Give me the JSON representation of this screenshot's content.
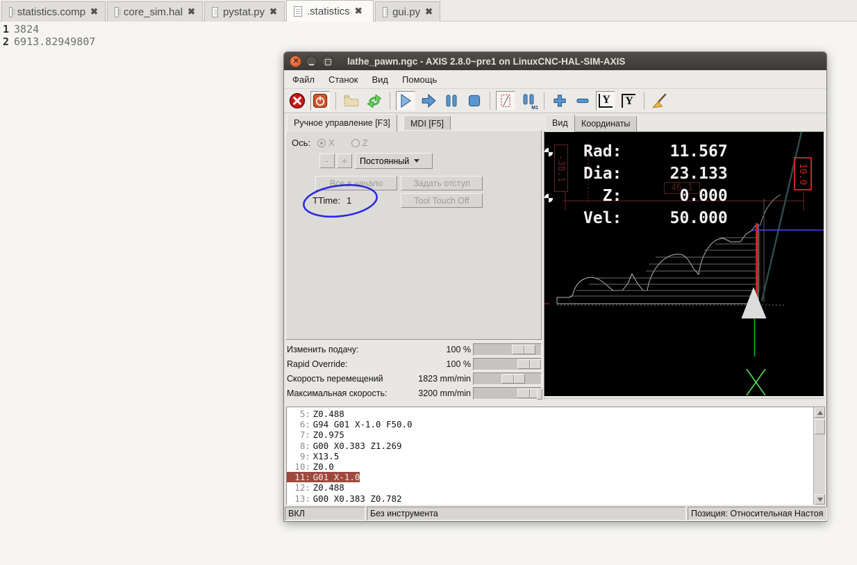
{
  "editor": {
    "tabs": [
      {
        "label": "statistics.comp"
      },
      {
        "label": "core_sim.hal"
      },
      {
        "label": "pystat.py"
      },
      {
        "label": ".statistics"
      },
      {
        "label": "gui.py"
      }
    ],
    "lines": [
      {
        "num": "1",
        "text": "3824"
      },
      {
        "num": "2",
        "text": "6913.82949807"
      }
    ]
  },
  "window": {
    "title": "lathe_pawn.ngc - AXIS 2.8.0~pre1 on LinuxCNC-HAL-SIM-AXIS",
    "menu": [
      "Файл",
      "Станок",
      "Вид",
      "Помощь"
    ]
  },
  "toolbar": {
    "m1_label": "M1",
    "view_y_label": "Y",
    "view_y2_label": "Y"
  },
  "left_panel": {
    "tab_manual": "Ручное управление [F3]",
    "tab_mdi": "MDI [F5]",
    "axis_label": "Ось:",
    "axis_x": "X",
    "axis_z": "Z",
    "jog_minus": "-",
    "jog_plus": "+",
    "jog_mode": "Постоянный",
    "home_all": "Все в начало",
    "set_offset": "Задать отступ",
    "ttime_label": "TTime:",
    "ttime_value": "1",
    "tool_touch_off": "Tool Touch Off"
  },
  "overrides": {
    "rows": [
      {
        "label": "Изменить подачу:",
        "value": "100 %"
      },
      {
        "label": "Rapid Override:",
        "value": "100 %"
      },
      {
        "label": "Скорость перемещений",
        "value": "1823 mm/min"
      },
      {
        "label": "Максимальная скорость:",
        "value": "3200 mm/min"
      }
    ]
  },
  "preview": {
    "tab_view": "Вид",
    "tab_coords": "Координаты",
    "dro": {
      "rad_label": "Rad:",
      "rad": "11.567",
      "dia_label": "Dia:",
      "dia": "23.133",
      "z_label": "Z:",
      "z": "0.000",
      "vel_label": "Vel:",
      "vel": "50.000"
    },
    "dims": {
      "left": "-38.1",
      "mid": "46.1",
      "right": "10.0"
    }
  },
  "gcode": {
    "lines": [
      {
        "num": "5:",
        "text": "Z0.488"
      },
      {
        "num": "6:",
        "text": "G94 G01 X-1.0 F50.0"
      },
      {
        "num": "7:",
        "text": "Z0.975"
      },
      {
        "num": "8:",
        "text": "G00 X0.383 Z1.269"
      },
      {
        "num": "9:",
        "text": "X13.5"
      },
      {
        "num": "10:",
        "text": "Z0.0"
      },
      {
        "num": "11:",
        "text": "G01 X-1.0"
      },
      {
        "num": "12:",
        "text": "Z0.488"
      },
      {
        "num": "13:",
        "text": "G00 X0.383 Z0.782"
      }
    ]
  },
  "statusbar": {
    "power": "ВКЛ",
    "tool": "Без инструмента",
    "position": "Позиция: Относительная Настоя"
  },
  "colors": {
    "highlight_line": "#9d4a3e",
    "dro_text": "#f2f2f2",
    "annotation_blue": "#2a2ae0",
    "dim_red_bright": "#cc2222",
    "dim_red_dark": "#6b2525",
    "tool_green": "#00bb00"
  }
}
